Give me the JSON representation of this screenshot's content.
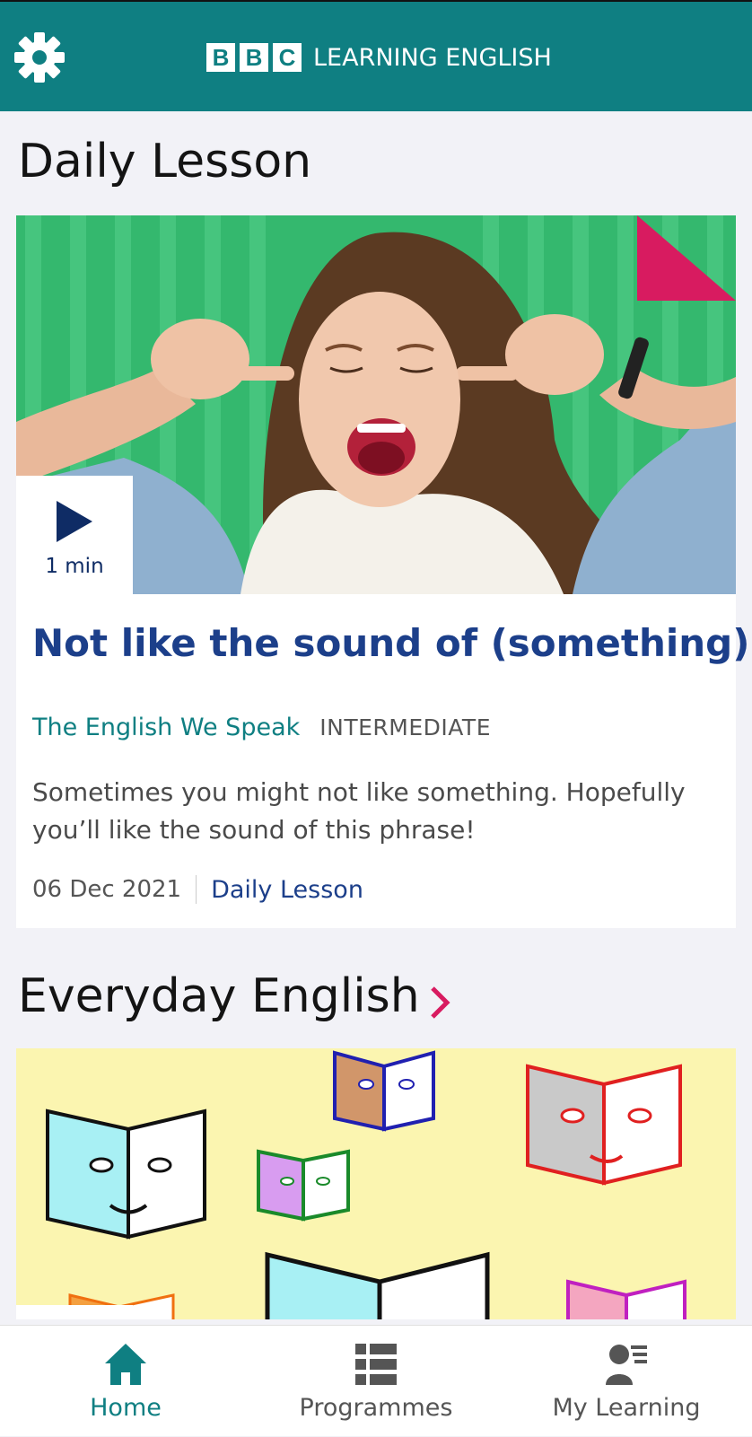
{
  "header": {
    "brand_letters": [
      "B",
      "B",
      "C"
    ],
    "brand_text": "LEARNING ENGLISH",
    "settings_icon": "gear-icon"
  },
  "daily": {
    "section_title": "Daily Lesson",
    "duration": "1 min",
    "title": "Not like the sound of (something)",
    "programme": "The English We Speak",
    "level": "INTERMEDIATE",
    "description": "Sometimes you might not like something. Hopefully you’ll like the sound of this phrase!",
    "date": "06 Dec 2021",
    "category": "Daily Lesson"
  },
  "everyday": {
    "section_title": "Everyday English"
  },
  "tabs": [
    {
      "label": "Home",
      "icon": "home-icon",
      "active": true
    },
    {
      "label": "Programmes",
      "icon": "list-icon",
      "active": false
    },
    {
      "label": "My Learning",
      "icon": "learner-icon",
      "active": false
    }
  ],
  "colors": {
    "brand_teal": "#0f7f82",
    "title_blue": "#1c3f8a",
    "accent_pink": "#d81b60"
  }
}
